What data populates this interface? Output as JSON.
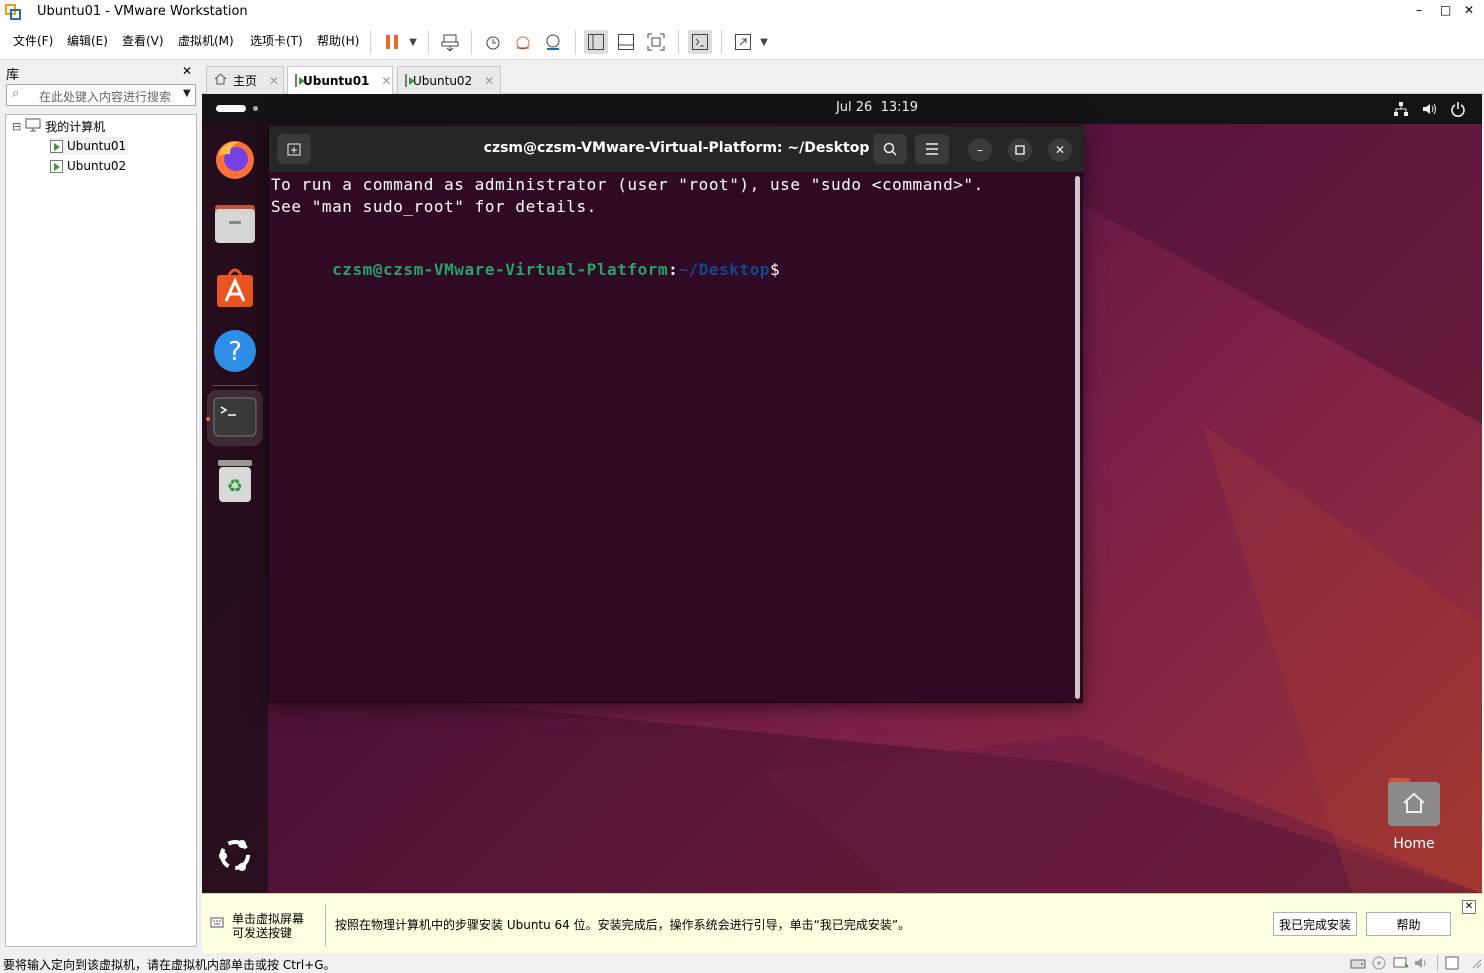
{
  "window": {
    "title": "Ubuntu01 - VMware Workstation",
    "minimize": "–",
    "maximize": "□",
    "close": "✕"
  },
  "menu": [
    "文件(F)",
    "编辑(E)",
    "查看(V)",
    "虚拟机(M)",
    "选项卡(T)",
    "帮助(H)"
  ],
  "library": {
    "title": "库",
    "close": "✕",
    "search_placeholder": "在此处键入内容进行搜索",
    "root": "我的计算机",
    "expander": "⊟",
    "vms": [
      "Ubuntu01",
      "Ubuntu02"
    ]
  },
  "tabs": [
    {
      "label": "主页",
      "icon": "home-icon"
    },
    {
      "label": "Ubuntu01",
      "icon": "vm-icon",
      "active": true
    },
    {
      "label": "Ubuntu02",
      "icon": "vm-icon"
    }
  ],
  "guest": {
    "clock": "Jul 26  13:19",
    "terminal": {
      "title": "czsm@czsm-VMware-Virtual-Platform: ~/Desktop",
      "lines": [
        "To run a command as administrator (user \"root\"), use \"sudo <command>\".",
        "See \"man sudo_root\" for details."
      ],
      "prompt_user": "czsm@czsm-VMware-Virtual-Platform",
      "prompt_sep": ":",
      "prompt_path": "~/Desktop",
      "prompt_end": "$"
    },
    "desktop_home_label": "Home",
    "dock_apps": [
      "Firefox",
      "Files",
      "App Center",
      "Help",
      "Terminal",
      "Trash",
      "Show Apps"
    ]
  },
  "notification": {
    "hint_line1": "单击虚拟屏幕",
    "hint_line2": "可发送按键",
    "message": "按照在物理计算机中的步骤安装 Ubuntu 64 位。安装完成后，操作系统会进行引导，单击“我已完成安装”。",
    "done_button": "我已完成安装",
    "help_button": "帮助",
    "close": "✕"
  },
  "status": {
    "text": "要将输入定向到该虚拟机，请在虚拟机内部单击或按 Ctrl+G。"
  },
  "colors": {
    "accent_orange": "#e95420",
    "prompt_green": "#26a269",
    "prompt_blue": "#12488b",
    "terminal_bg": "#300a24"
  }
}
